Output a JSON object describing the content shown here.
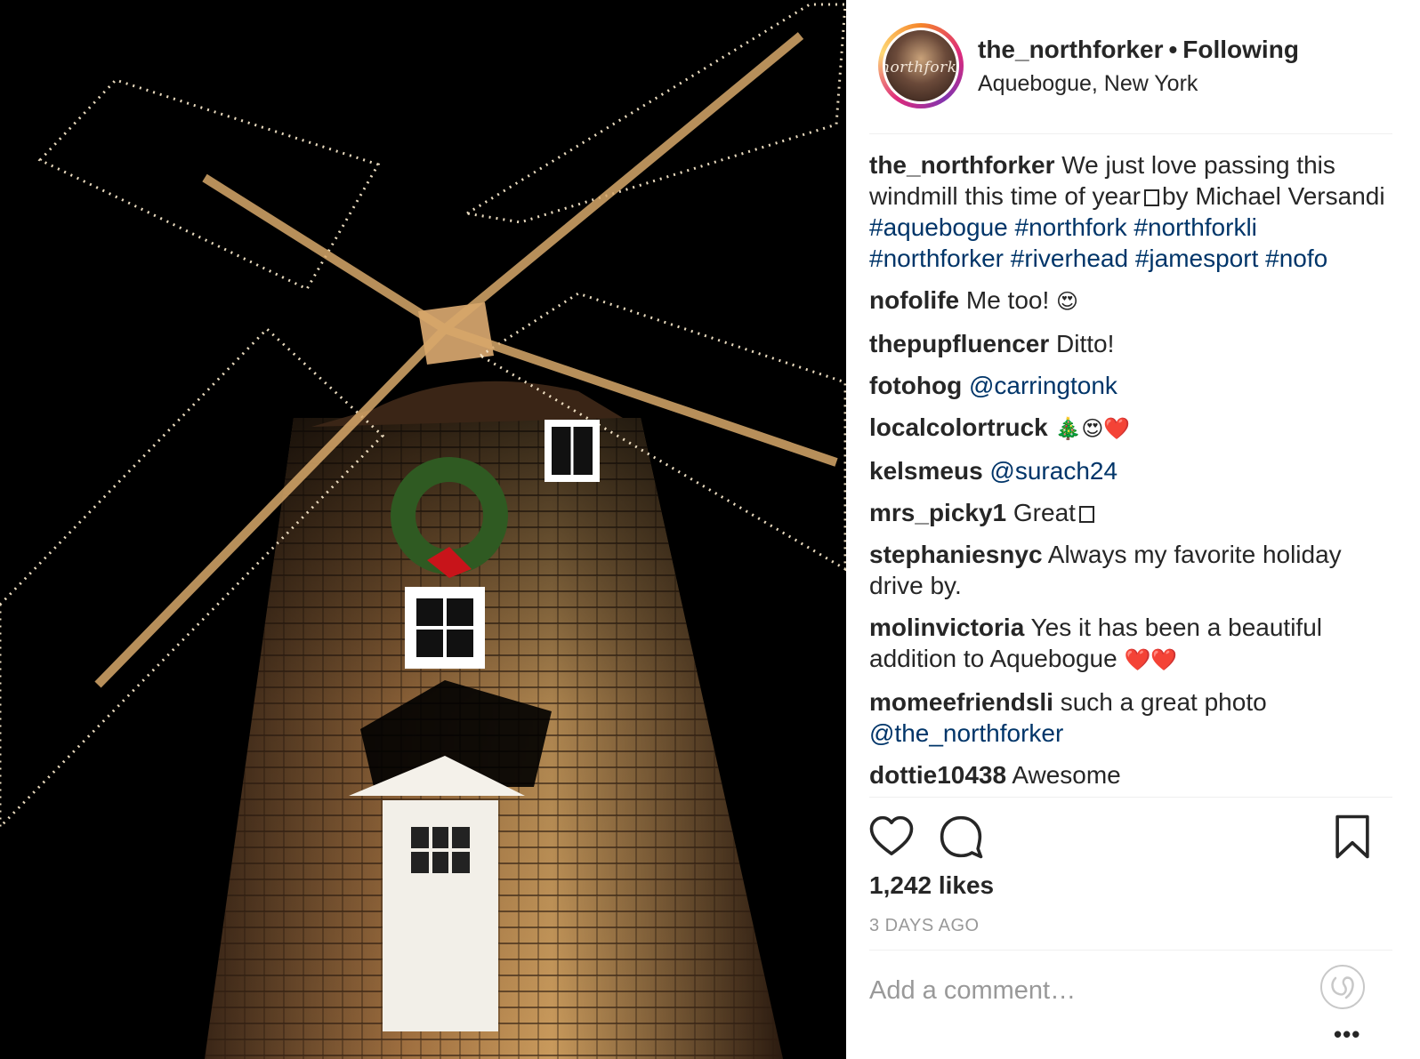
{
  "post": {
    "username": "the_northforker",
    "follow_status": "Following",
    "separator": "•",
    "location": "Aquebogue, New York",
    "avatar_text": "northforker",
    "photo_alt": "Windmill decorated with string lights at night, with a wreath above a window"
  },
  "caption": {
    "username": "the_northforker",
    "text_1": "We just love passing this windmill this time of year",
    "text_2": "by Michael Versandi",
    "hashtags": [
      "#aquebogue",
      "#northfork",
      "#northforkli",
      "#northforker",
      "#riverhead",
      "#jamesport",
      "#nofo"
    ]
  },
  "comments": [
    {
      "user": "nofolife",
      "text": "Me too!",
      "emoji": "😍",
      "mention": ""
    },
    {
      "user": "thepupfluencer",
      "text": "Ditto!",
      "emoji": "",
      "mention": ""
    },
    {
      "user": "fotohog",
      "text": "",
      "emoji": "",
      "mention": "@carringtonk"
    },
    {
      "user": "localcolortruck",
      "text": "",
      "emoji": "🎄😍❤️",
      "mention": ""
    },
    {
      "user": "kelsmeus",
      "text": "",
      "emoji": "",
      "mention": "@surach24"
    },
    {
      "user": "mrs_picky1",
      "text": "Great",
      "emoji": "",
      "mention": "",
      "box": true
    },
    {
      "user": "stephaniesnyc",
      "text": "Always my favorite holiday drive by.",
      "emoji": "",
      "mention": ""
    },
    {
      "user": "molinvictoria",
      "text": "Yes it has been a beautiful addition to Aquebogue",
      "emoji": "❤️❤️",
      "mention": ""
    },
    {
      "user": "momeefriendsli",
      "text": "such a great photo",
      "emoji": "",
      "mention": "@the_northforker"
    },
    {
      "user": "dottie10438",
      "text": "Awesome",
      "emoji": "",
      "mention": ""
    }
  ],
  "actions": {
    "like_icon": "heart-icon",
    "comment_icon": "comment-bubble-icon",
    "save_icon": "bookmark-icon",
    "likes": "1,242 likes",
    "time_ago": "3 DAYS AGO"
  },
  "add_comment": {
    "placeholder": "Add a comment…",
    "more": "•••"
  },
  "colors": {
    "link": "#003569",
    "muted": "#999999",
    "text": "#262626",
    "divider": "#efefef"
  }
}
